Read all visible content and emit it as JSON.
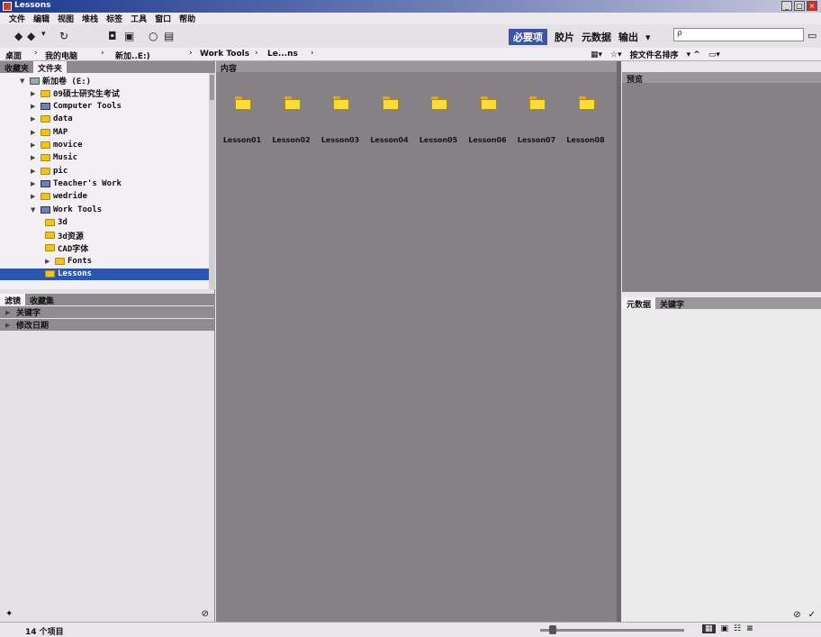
{
  "window": {
    "title": "Lessons"
  },
  "menu": [
    "文件",
    "编辑",
    "视图",
    "堆栈",
    "标签",
    "工具",
    "窗口",
    "帮助"
  ],
  "workspaces": {
    "active": "必要项",
    "items": [
      "胶片",
      "元数据",
      "输出"
    ]
  },
  "search": {
    "placeholder": "ρ"
  },
  "path": [
    "桌面",
    "我的电脑",
    "新加..E:)",
    "Work Tools",
    "Le...ns"
  ],
  "path_right": {
    "sort_label": "按文件名排序"
  },
  "left_tabs": [
    "收藏夹",
    "文件夹"
  ],
  "tree": [
    {
      "label": "新加卷 (E:)",
      "kind": "drive",
      "level": 1
    },
    {
      "label": "09硕士研究生考试",
      "kind": "folder",
      "level": 2
    },
    {
      "label": "Computer Tools",
      "kind": "pc",
      "level": 2
    },
    {
      "label": "data",
      "kind": "folder",
      "level": 2
    },
    {
      "label": "MAP",
      "kind": "folder",
      "level": 2
    },
    {
      "label": "movice",
      "kind": "folder",
      "level": 2
    },
    {
      "label": "Music",
      "kind": "folder",
      "level": 2
    },
    {
      "label": "pic",
      "kind": "folder",
      "level": 2
    },
    {
      "label": "Teacher's Work",
      "kind": "pc",
      "level": 2
    },
    {
      "label": "wedride",
      "kind": "folder",
      "level": 2
    },
    {
      "label": "Work Tools",
      "kind": "pc",
      "level": 2
    },
    {
      "label": "3d",
      "kind": "folder",
      "level": 3
    },
    {
      "label": "3d资源",
      "kind": "folder",
      "level": 3
    },
    {
      "label": "CAD字体",
      "kind": "folder",
      "level": 3
    },
    {
      "label": "Fonts",
      "kind": "folder",
      "level": 3
    },
    {
      "label": "Lessons",
      "kind": "folder",
      "level": 3,
      "selected": true
    }
  ],
  "filter_tabs": [
    "滤镜",
    "收藏集"
  ],
  "filters": [
    "关键字",
    "修改日期"
  ],
  "content": {
    "header": "内容",
    "items": [
      "Lesson01",
      "Lesson02",
      "Lesson03",
      "Lesson04",
      "Lesson05",
      "Lesson06",
      "Lesson07",
      "Lesson08"
    ]
  },
  "preview": {
    "header": "预览"
  },
  "meta_tabs": [
    "元数据",
    "关键字"
  ],
  "status": {
    "count": "14 个项目"
  }
}
